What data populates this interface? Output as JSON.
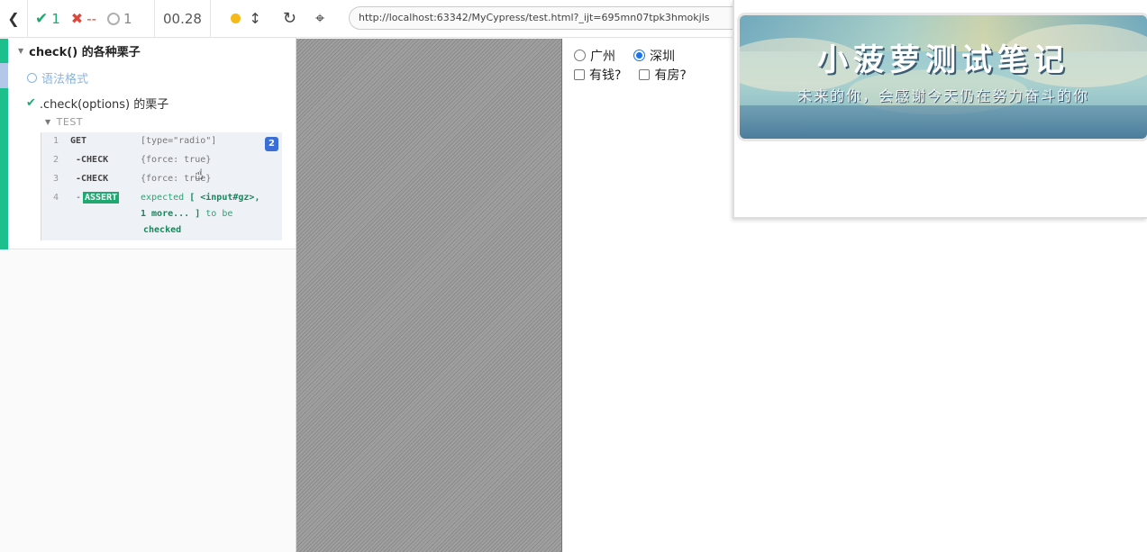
{
  "reporter": {
    "stats": {
      "passed": "1",
      "failed": "--",
      "pending": "1"
    },
    "duration": "00.28",
    "suite_title": "check() 的各种栗子",
    "tests": [
      {
        "title": "语法格式",
        "state": "pending"
      },
      {
        "title": ".check(options) 的栗子",
        "state": "passed"
      }
    ],
    "test_label": "TEST",
    "commands": [
      {
        "num": "1",
        "name": "GET",
        "message": "[type=\"radio\"]",
        "badge": "2"
      },
      {
        "num": "2",
        "name": "-CHECK",
        "message": "{force: true}"
      },
      {
        "num": "3",
        "name": "-CHECK",
        "message": "{force: true}"
      },
      {
        "num": "4",
        "name": "ASSERT",
        "dash": "-",
        "msg_part1": "expected",
        "msg_part2": "[ <input#gz>,",
        "msg_part3": "1 more... ]",
        "msg_part4": "to be",
        "msg_part5": "checked"
      }
    ]
  },
  "aut": {
    "url": "http://localhost:63342/MyCypress/test.html?_ijt=695mn07tpk3hmokjls",
    "radios": [
      {
        "label": "广州",
        "checked": false
      },
      {
        "label": "深圳",
        "checked": true
      }
    ],
    "checkboxes": [
      {
        "label": "有钱?",
        "checked": false
      },
      {
        "label": "有房?",
        "checked": false
      }
    ]
  },
  "banner": {
    "title": "小菠萝测试笔记",
    "subtitle": "未来的你，会感谢今天仍在努力奋斗的你"
  },
  "colors": {
    "pass": "#1fa971",
    "fail": "#e0463a",
    "pending": "#8ab4de",
    "running": "#f5b919",
    "badge": "#3b6fd6"
  }
}
